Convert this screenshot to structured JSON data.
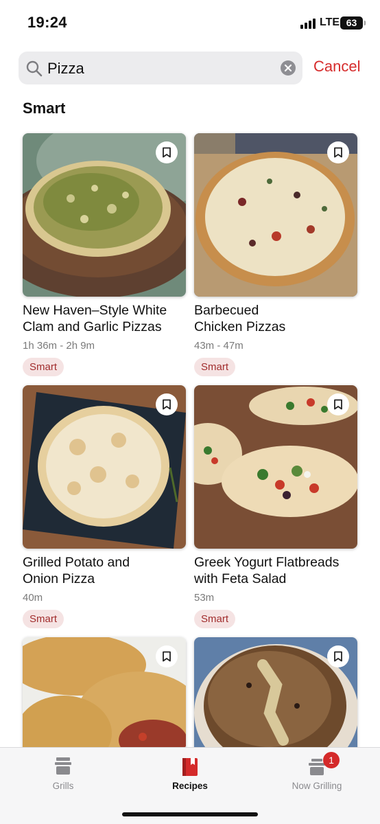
{
  "status_bar": {
    "time": "19:24",
    "network": "LTE",
    "battery": "63"
  },
  "search": {
    "query": "Pizza",
    "cancel_label": "Cancel"
  },
  "section_title": "Smart",
  "recipes": [
    {
      "title_line1": "New Haven–Style White",
      "title_line2": "Clam and Garlic Pizzas",
      "time": "1h 36m - 2h 9m",
      "badge": "Smart"
    },
    {
      "title_line1": "Barbecued",
      "title_line2": "Chicken Pizzas",
      "time": "43m - 47m",
      "badge": "Smart"
    },
    {
      "title_line1": "Grilled Potato and",
      "title_line2": "Onion Pizza",
      "time": "40m",
      "badge": "Smart"
    },
    {
      "title_line1": "Greek Yogurt Flatbreads",
      "title_line2": "with Feta Salad",
      "time": "53m",
      "badge": "Smart"
    },
    {
      "title_line1": "",
      "title_line2": "",
      "time": "",
      "badge": ""
    },
    {
      "title_line1": "",
      "title_line2": "",
      "time": "",
      "badge": ""
    }
  ],
  "tab_bar": {
    "tabs": [
      {
        "label": "Grills",
        "icon": "grill-icon"
      },
      {
        "label": "Recipes",
        "icon": "recipe-book-icon"
      },
      {
        "label": "Now Grilling",
        "icon": "now-grilling-icon",
        "badge": "1"
      }
    ],
    "active_index": 1
  },
  "colors": {
    "accent": "#d62c2c",
    "badge_bg": "#f5e3e3",
    "badge_text": "#a12d2d"
  }
}
